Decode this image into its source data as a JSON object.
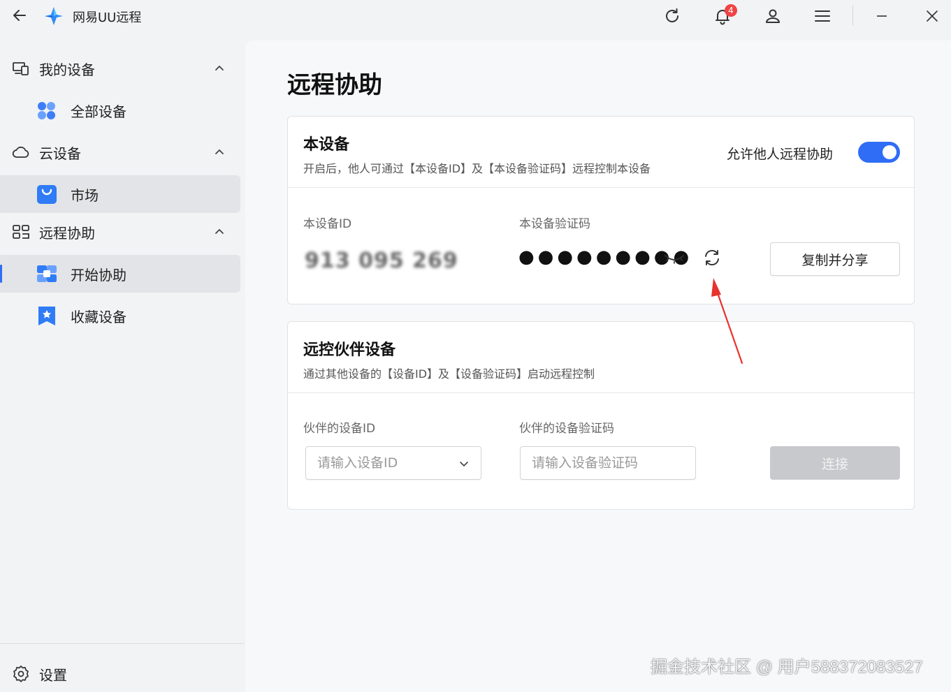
{
  "app": {
    "title": "网易UU远程"
  },
  "titlebar": {
    "notification_count": "4"
  },
  "sidebar": {
    "groups": [
      {
        "label": "我的设备",
        "items": [
          {
            "label": "全部设备"
          }
        ]
      },
      {
        "label": "云设备",
        "items": [
          {
            "label": "市场"
          }
        ]
      },
      {
        "label": "远程协助",
        "items": [
          {
            "label": "开始协助"
          },
          {
            "label": "收藏设备"
          }
        ]
      }
    ],
    "settings_label": "设置"
  },
  "main": {
    "title": "远程协助",
    "this_device": {
      "title": "本设备",
      "desc": "开启后，他人可通过【本设备ID】及【本设备验证码】远程控制本设备",
      "toggle_label": "允许他人远程协助",
      "toggle_on": true,
      "id_label": "本设备ID",
      "id_value": "913 095 269",
      "code_label": "本设备验证码",
      "code_value": "●●●●●●●●●",
      "share_button": "复制并分享"
    },
    "partner": {
      "title": "远控伙伴设备",
      "desc": "通过其他设备的【设备ID】及【设备验证码】启动远程控制",
      "id_label": "伙伴的设备ID",
      "id_placeholder": "请输入设备ID",
      "code_label": "伙伴的设备验证码",
      "code_placeholder": "请输入设备验证码",
      "connect_button": "连接"
    }
  },
  "watermark": "掘金技术社区 @ 用户588372083527",
  "colors": {
    "accent": "#2f6df6",
    "annotation_arrow": "#e8322d"
  }
}
